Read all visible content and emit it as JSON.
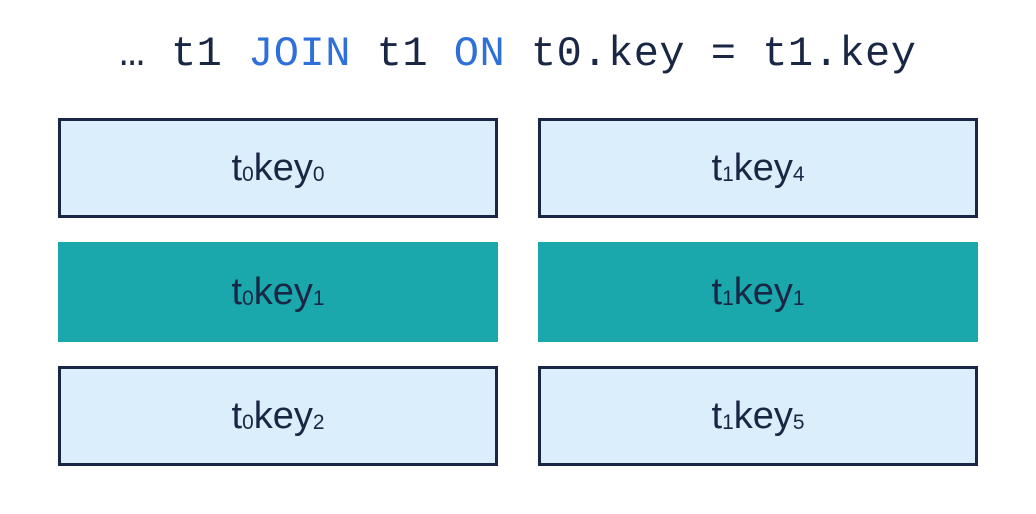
{
  "title": {
    "prefix": "… ",
    "t1a": "t1",
    "join": " JOIN ",
    "t1b": "t1",
    "on": " ON ",
    "condition": "t0.key = t1.key"
  },
  "columns": {
    "left": [
      {
        "table_sub": "0",
        "key_label": "key",
        "key_sub": "0",
        "highlight": false
      },
      {
        "table_sub": "0",
        "key_label": "key",
        "key_sub": "1",
        "highlight": true
      },
      {
        "table_sub": "0",
        "key_label": "key",
        "key_sub": "2",
        "highlight": false
      }
    ],
    "right": [
      {
        "table_sub": "1",
        "key_label": "key",
        "key_sub": "4",
        "highlight": false
      },
      {
        "table_sub": "1",
        "key_label": "key",
        "key_sub": "1",
        "highlight": true
      },
      {
        "table_sub": "1",
        "key_label": "key",
        "key_sub": "5",
        "highlight": false
      }
    ]
  }
}
